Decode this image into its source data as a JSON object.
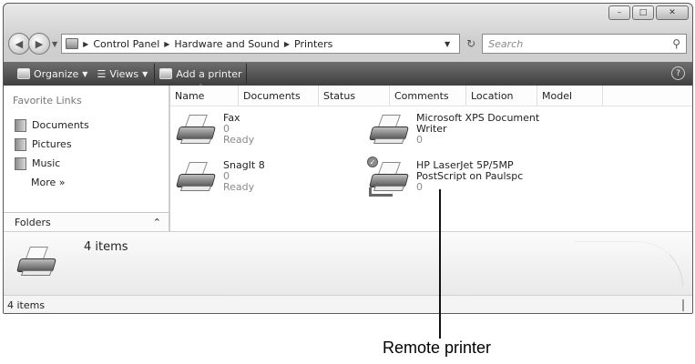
{
  "window": {
    "controls": [
      "–",
      "□",
      "✕"
    ]
  },
  "address_bar": {
    "breadcrumbs": [
      "Control Panel",
      "Hardware and Sound",
      "Printers"
    ],
    "search_placeholder": "Search"
  },
  "toolbar": {
    "organize": "Organize",
    "views": "Views",
    "add_printer": "Add a printer",
    "help": "?"
  },
  "nav_pane": {
    "heading": "Favorite Links",
    "items": [
      {
        "label": "Documents",
        "icon": "documents-icon"
      },
      {
        "label": "Pictures",
        "icon": "pictures-icon"
      },
      {
        "label": "Music",
        "icon": "music-icon"
      }
    ],
    "more": "More »",
    "folders": "Folders"
  },
  "columns": [
    "Name",
    "Documents",
    "Status",
    "Comments",
    "Location",
    "Model"
  ],
  "printers": [
    {
      "name": "Fax",
      "line2": "0",
      "line3": "Ready"
    },
    {
      "name": "Microsoft XPS Document",
      "line2": "Writer",
      "line3": "0"
    },
    {
      "name": "SnagIt 8",
      "line2": "0",
      "line3": "Ready"
    },
    {
      "name": "HP LaserJet 5P/5MP",
      "line2": "PostScript on Paulspc",
      "line3": "0",
      "default": true,
      "remote": true
    }
  ],
  "details_pane": {
    "count": "4 items"
  },
  "status_bar": {
    "text": "4 items"
  },
  "annotation": {
    "label": "Remote printer"
  }
}
